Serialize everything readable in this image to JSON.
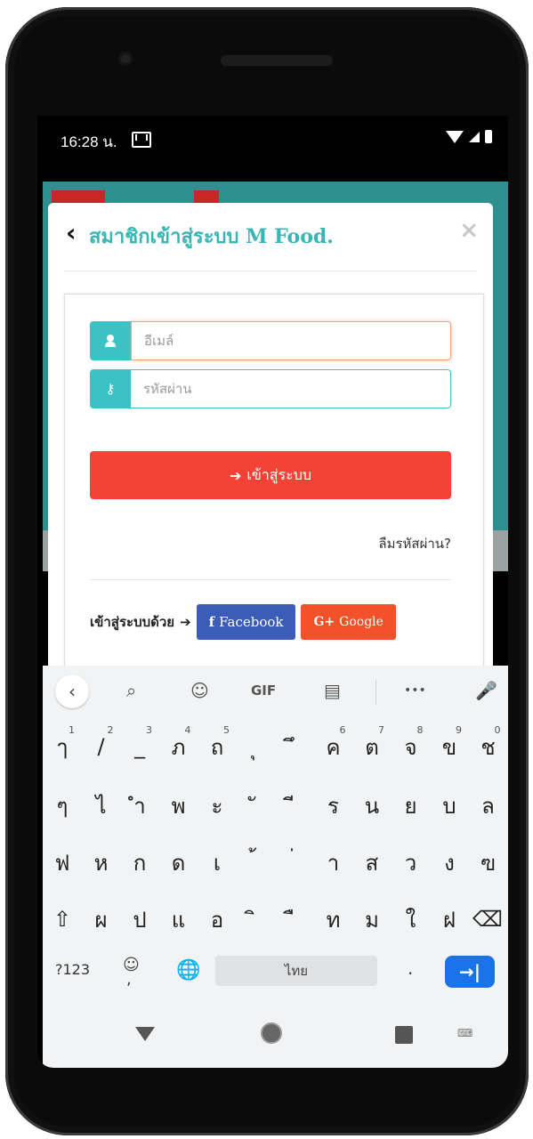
{
  "status_bar": {
    "time": "16:28 น."
  },
  "modal": {
    "back_icon": "‹",
    "title": "สมาชิกเข้าสู่ระบบ M Food.",
    "close_icon": "×"
  },
  "login_form": {
    "email_placeholder": "อีเมล์",
    "password_placeholder": "รหัสผ่าน",
    "login_button": "เข้าสู่ระบบ",
    "forgot_password": "ลืมรหัสผ่าน?",
    "social_label": "เข้าสู่ระบบด้วย",
    "facebook_button": "Facebook",
    "google_button": "Google",
    "colors": {
      "accent": "#3cc2c4",
      "login": "#f44336",
      "facebook": "#3b5db8",
      "google": "#f2512a"
    }
  },
  "keyboard": {
    "toolbar": [
      "search-icon",
      "sticker-icon",
      "GIF",
      "clipboard-icon",
      "more-icon",
      "mic-icon"
    ],
    "gif_label": "GIF",
    "more_label": "•••",
    "row1": [
      {
        "char": "ๅ",
        "hint": "1"
      },
      {
        "char": "/",
        "hint": "2"
      },
      {
        "char": "_",
        "hint": "3"
      },
      {
        "char": "ภ",
        "hint": "4"
      },
      {
        "char": "ถ",
        "hint": "5"
      },
      {
        "char": "ุ",
        "hint": ""
      },
      {
        "char": "ึ",
        "hint": ""
      },
      {
        "char": "ค",
        "hint": "6"
      },
      {
        "char": "ต",
        "hint": "7"
      },
      {
        "char": "จ",
        "hint": "8"
      },
      {
        "char": "ข",
        "hint": "9"
      },
      {
        "char": "ช",
        "hint": "0"
      }
    ],
    "row2": [
      "ๆ",
      "ไ",
      "ำ",
      "พ",
      "ะ",
      "ั",
      "ี",
      "ร",
      "น",
      "ย",
      "บ",
      "ล"
    ],
    "row3": [
      "ฟ",
      "ห",
      "ก",
      "ด",
      "เ",
      "้",
      "่",
      "า",
      "ส",
      "ว",
      "ง",
      "ฃ"
    ],
    "row4": [
      "ผ",
      "ป",
      "แ",
      "อ",
      "ิ",
      "ื",
      "ท",
      "ม",
      "ใ",
      "ฝ"
    ],
    "shift_icon": "⇧",
    "backspace_icon": "⌫",
    "symbols_label": "?123",
    "emoji_icon": "☺",
    "comma": ",",
    "globe_icon": "🌐",
    "space_label": "ไทย",
    "period": ".",
    "enter_icon": "→|"
  }
}
